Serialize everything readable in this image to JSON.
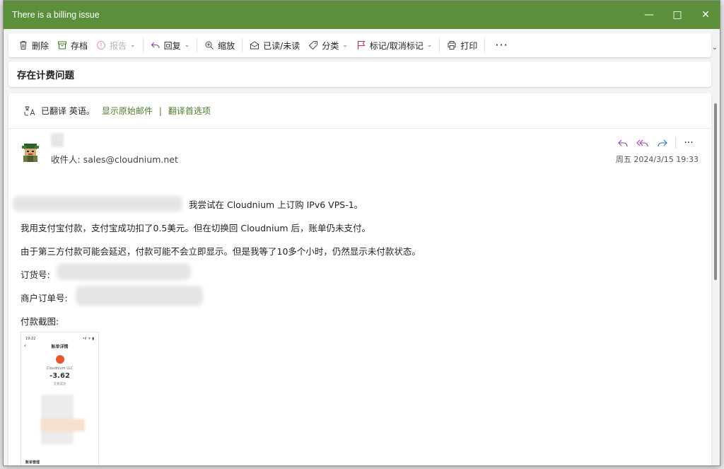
{
  "window": {
    "title": "There is a billing issue"
  },
  "toolbar": {
    "delete": "删除",
    "archive": "存档",
    "report": "报告",
    "reply": "回复",
    "zoom": "缩放",
    "read_unread": "已读/未读",
    "categorize": "分类",
    "flag": "标记/取消标记",
    "print": "打印",
    "more": "···"
  },
  "message": {
    "subject": "存在计费问题",
    "translation": {
      "status": "已翻译 英语。",
      "show_original": "显示原始邮件",
      "preferences": "翻译首选项"
    },
    "to": "收件人: sales@cloudnium.net",
    "date": "周五 2024/3/15 19:33",
    "body": {
      "line1": "我尝试在 Cloudnium 上订购 IPv6 VPS-1。",
      "line2": "我用支付宝付款，支付宝成功扣了0.5美元。但在切换回 Cloudnium 后，账单仍未支付。",
      "line3": "由于第三方付款可能会延迟，付款可能不会立即显示。但是我等了10多个小时，仍然显示未付款状态。",
      "order_label": "订货号:",
      "merchant_order_label": "商户订单号:",
      "screenshot_label": "付款截图:"
    },
    "screenshot": {
      "time": "19:22",
      "signal": "•ıl ᯤ ▮",
      "header": "账单详情",
      "merchant": "Cloudnium LLC",
      "amount": "-3.62",
      "status": "交易成功",
      "footer": "账单管理"
    }
  }
}
